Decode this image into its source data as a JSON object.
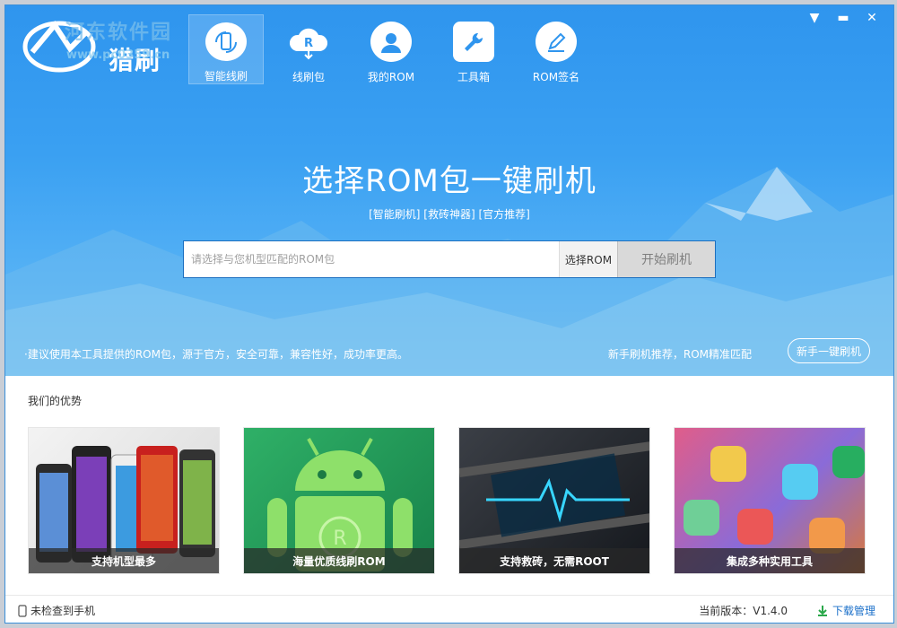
{
  "app": {
    "name": "猎刷"
  },
  "watermark": {
    "title": "河东软件园",
    "url": "www.pc0359.cn"
  },
  "nav": [
    {
      "label": "智能线刷",
      "icon": "phone-refresh-icon"
    },
    {
      "label": "线刷包",
      "icon": "cloud-rom-icon"
    },
    {
      "label": "我的ROM",
      "icon": "user-icon"
    },
    {
      "label": "工具箱",
      "icon": "wrench-icon"
    },
    {
      "label": "ROM签名",
      "icon": "pen-icon"
    }
  ],
  "hero": {
    "title": "选择ROM包一键刷机",
    "tags": "[智能刷机] [救砖神器] [官方推荐]",
    "search_placeholder": "请选择与您机型匹配的ROM包",
    "select_button": "选择ROM",
    "start_button": "开始刷机",
    "tip": "·建议使用本工具提供的ROM包，源于官方，安全可靠，兼容性好，成功率更高。",
    "recommend": "新手刷机推荐，ROM精准匹配",
    "newbie_button": "新手一键刷机"
  },
  "advantages": {
    "title": "我们的优势",
    "cards": [
      {
        "caption": "支持机型最多"
      },
      {
        "caption": "海量优质线刷ROM"
      },
      {
        "caption": "支持救砖，无需ROOT"
      },
      {
        "caption": "集成多种实用工具"
      }
    ]
  },
  "status": {
    "phone": "未检查到手机",
    "version": "当前版本：V1.4.0",
    "download": "下载管理"
  },
  "colors": {
    "accent": "#2f95ee",
    "link": "#1a6fc9"
  }
}
